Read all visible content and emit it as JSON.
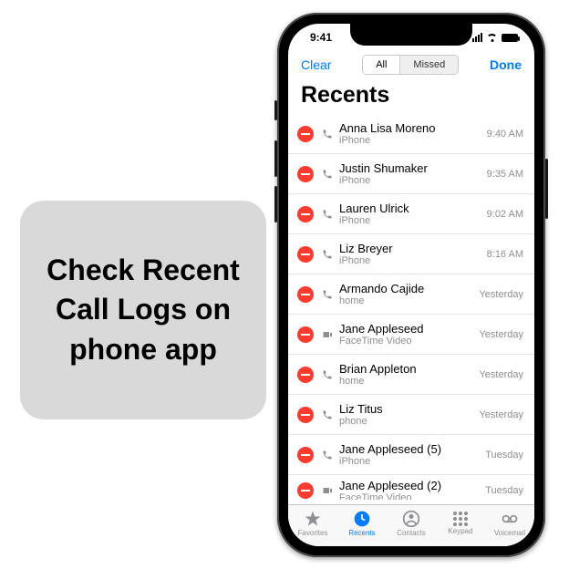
{
  "caption": "Check Recent Call Logs on phone app",
  "status": {
    "time": "9:41"
  },
  "nav": {
    "left": "Clear",
    "right": "Done",
    "seg_all": "All",
    "seg_missed": "Missed"
  },
  "title": "Recents",
  "calls": [
    {
      "name": "Anna Lisa Moreno",
      "source": "iPhone",
      "time": "9:40 AM",
      "icon": "phone"
    },
    {
      "name": "Justin Shumaker",
      "source": "iPhone",
      "time": "9:35 AM",
      "icon": "phone"
    },
    {
      "name": "Lauren Ulrick",
      "source": "iPhone",
      "time": "9:02 AM",
      "icon": "phone"
    },
    {
      "name": "Liz Breyer",
      "source": "iPhone",
      "time": "8:16 AM",
      "icon": "phone"
    },
    {
      "name": "Armando Cajide",
      "source": "home",
      "time": "Yesterday",
      "icon": "phone"
    },
    {
      "name": "Jane Appleseed",
      "source": "FaceTime Video",
      "time": "Yesterday",
      "icon": "video"
    },
    {
      "name": "Brian Appleton",
      "source": "home",
      "time": "Yesterday",
      "icon": "phone"
    },
    {
      "name": "Liz Titus",
      "source": "phone",
      "time": "Yesterday",
      "icon": "phone"
    },
    {
      "name": "Jane Appleseed (5)",
      "source": "iPhone",
      "time": "Tuesday",
      "icon": "phone"
    },
    {
      "name": "Jane Appleseed (2)",
      "source": "FaceTime Video",
      "time": "Tuesday",
      "icon": "video"
    }
  ],
  "tabs": {
    "favorites": "Favorites",
    "recents": "Recents",
    "contacts": "Contacts",
    "keypad": "Keypad",
    "voicemail": "Voicemail"
  }
}
